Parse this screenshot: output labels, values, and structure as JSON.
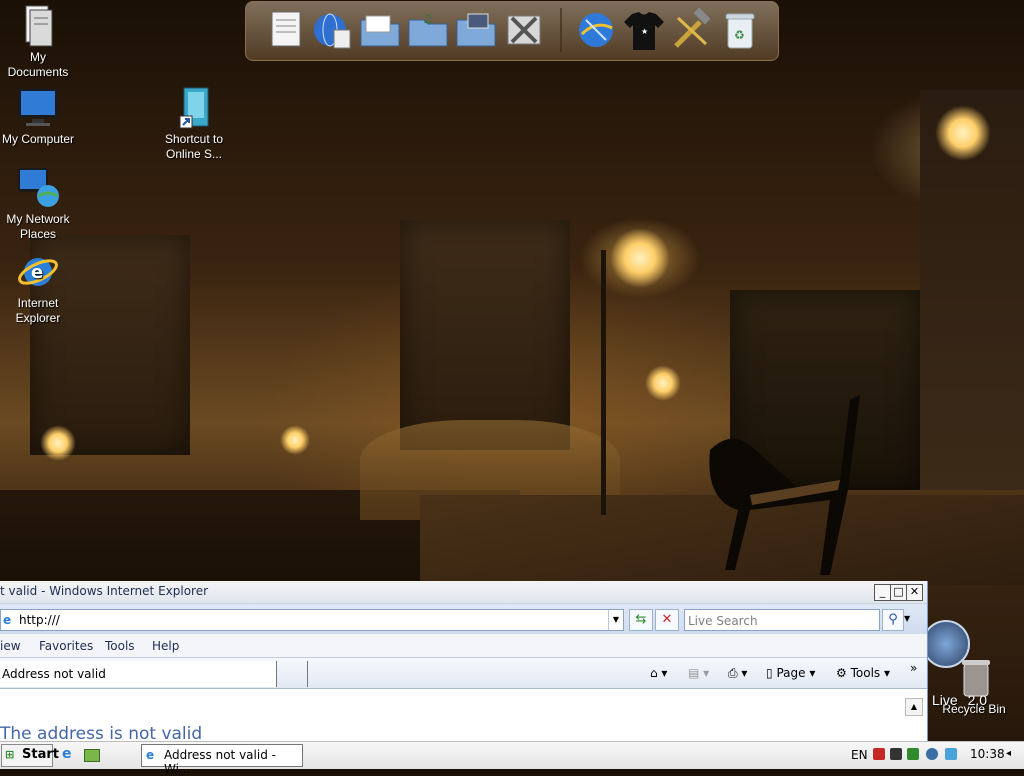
{
  "desktop": {
    "icons": [
      {
        "label": "My\nDocuments"
      },
      {
        "label": "My Computer"
      },
      {
        "label": "My Network\nPlaces"
      },
      {
        "label": "Internet\nExplorer"
      },
      {
        "label": "Shortcut to\nOnline S..."
      },
      {
        "label": "Recycle Bin"
      }
    ],
    "overlay_text": "Live ",
    "overlay_version": "2.0"
  },
  "dock": {
    "items": [
      "document-icon",
      "globe-icon",
      "folder-icon",
      "folder-music-icon",
      "folder-pictures-icon",
      "tools-icon",
      "internet-icon",
      "tshirt-icon",
      "hammer-icon",
      "trash-icon"
    ]
  },
  "ie": {
    "title": "t valid - Windows Internet Explorer",
    "address": "http:///",
    "search_placeholder": "Live Search",
    "menu": [
      "iew",
      "Favorites",
      "Tools",
      "Help"
    ],
    "tab_label": "Address not valid",
    "cmd": {
      "page": "Page",
      "tools": "Tools",
      "more": "»"
    },
    "content_heading": "The address is not valid"
  },
  "taskbar": {
    "start": "Start",
    "task_label": "Address not valid - Wi...",
    "lang": "EN",
    "clock": "10:38"
  },
  "colors": {
    "accent": "#3b6ea5",
    "title_text": "#1e2d52"
  }
}
